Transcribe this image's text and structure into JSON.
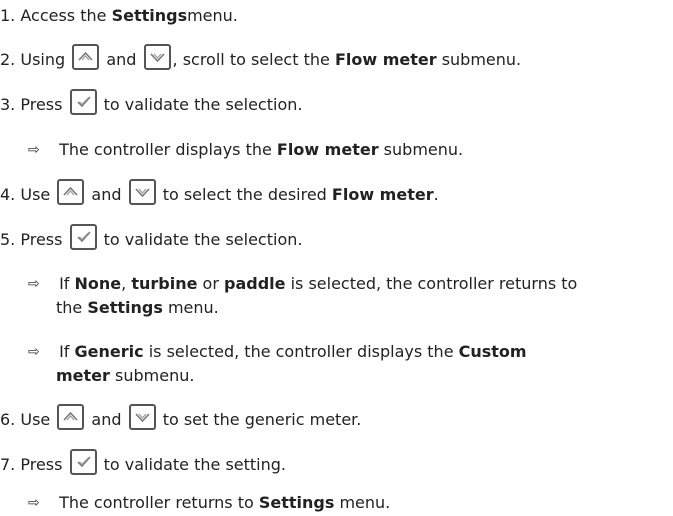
{
  "steps": [
    {
      "num": "1.",
      "pre": " Access the ",
      "bold": "Settings",
      "post": " menu."
    },
    {
      "num": "2.",
      "pre": " Using ",
      "mid": " and ",
      "post1": ", scroll to select the ",
      "bold": "Flow meter",
      "post2": " submenu."
    },
    {
      "num": "3.",
      "pre": " Press ",
      "post": " to validate the selection."
    },
    {
      "num": "4.",
      "pre": " Use ",
      "mid": " and ",
      "post1": " to select the desired ",
      "bold": "Flow meter",
      "post2": "."
    },
    {
      "num": "5.",
      "pre": " Press ",
      "post": " to validate the selection."
    },
    {
      "num": "6.",
      "pre": " Use ",
      "mid": " and ",
      "post": " to set the generic meter."
    },
    {
      "num": "7.",
      "pre": " Press ",
      "post": " to validate the setting."
    }
  ],
  "results": {
    "r3": {
      "arrow": "⇨",
      "pre": " The controller displays the ",
      "bold": "Flow meter",
      "post": " submenu."
    },
    "r5a": {
      "arrow": "⇨",
      "pre": " If ",
      "b1": "None",
      "m1": ", ",
      "b2": "turbine",
      "m2": " or ",
      "b3": "paddle",
      "m3": " is selected, the controller returns to",
      "line2_pre": "the ",
      "line2_bold": "Settings",
      "line2_post": " menu."
    },
    "r5b": {
      "arrow": "⇨",
      "pre": " If ",
      "b1": "Generic",
      "m1": " is selected, the controller displays the ",
      "b2": "Custom",
      "line2_bold": "meter",
      "line2_post": " submenu."
    },
    "r7": {
      "arrow": "⇨",
      "pre": " The controller returns to ",
      "bold": "Settings",
      "post": " menu."
    }
  },
  "icons": {
    "up": "up-arrow-key",
    "down": "down-arrow-key",
    "ok": "validate-check-key"
  }
}
